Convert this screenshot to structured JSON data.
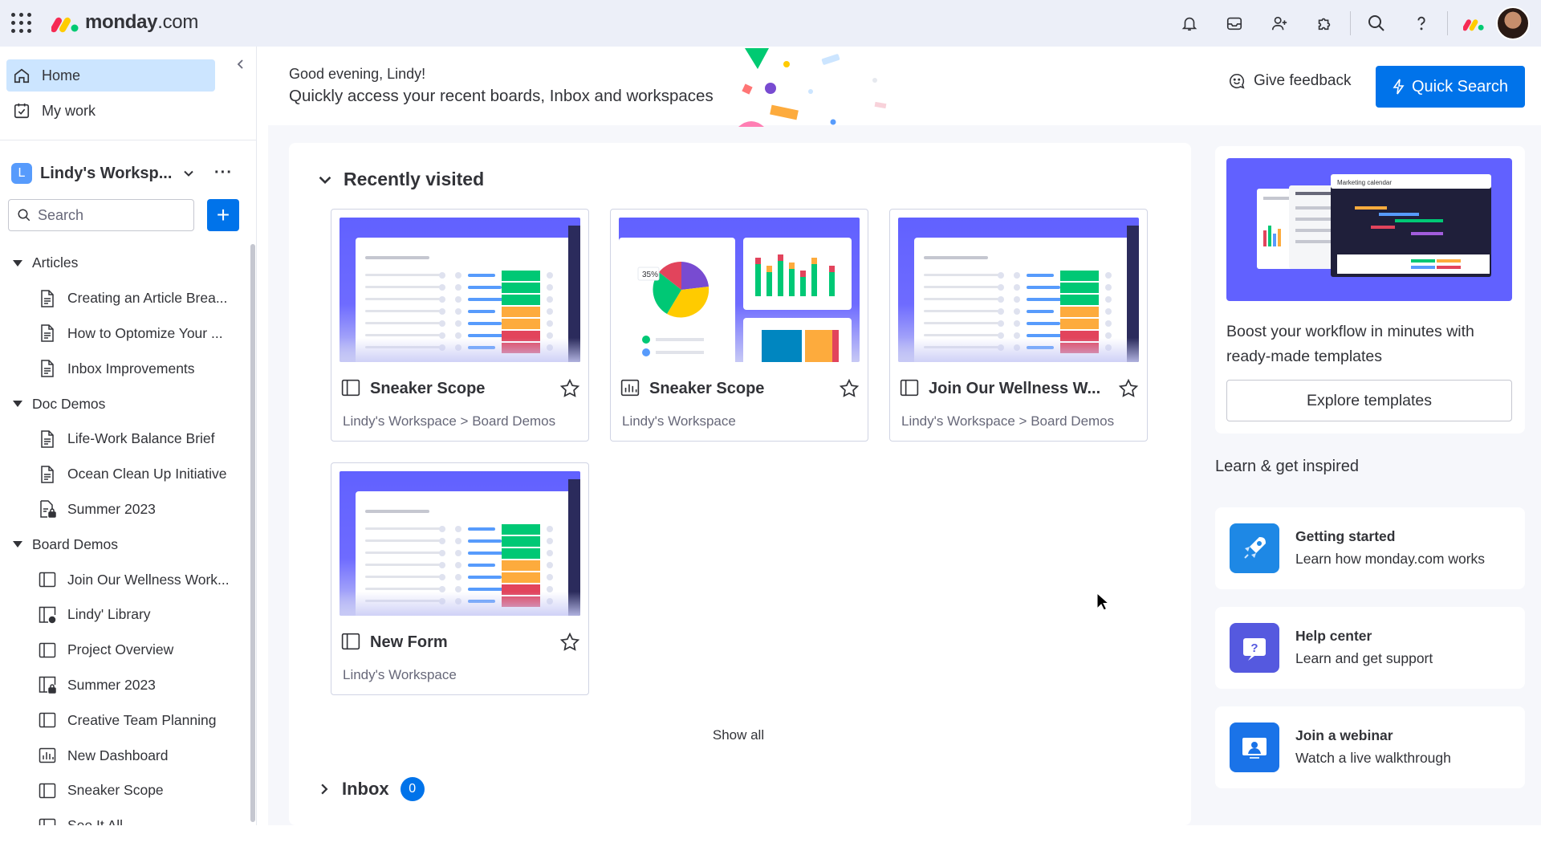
{
  "app": {
    "logo_bold": "monday",
    "logo_suffix": ".com"
  },
  "topbar": {
    "icons": [
      "bell-icon",
      "inbox-tray-icon",
      "invite-user-icon",
      "puzzle-icon",
      "search-icon",
      "help-icon",
      "monday-logo-icon",
      "avatar"
    ]
  },
  "sidebar": {
    "nav": [
      {
        "label": "Home",
        "icon": "home-icon",
        "active": true
      },
      {
        "label": "My work",
        "icon": "calendar-check-icon",
        "active": false
      }
    ],
    "workspace": {
      "badge": "L",
      "name": "Lindy's Worksp...",
      "more": "···"
    },
    "search_placeholder": "Search",
    "add_label": "+",
    "tree": [
      {
        "type": "folder",
        "label": "Articles"
      },
      {
        "type": "doc",
        "label": "Creating an Article Brea..."
      },
      {
        "type": "doc",
        "label": "How to Optomize Your ..."
      },
      {
        "type": "doc",
        "label": "Inbox Improvements"
      },
      {
        "type": "folder",
        "label": "Doc Demos"
      },
      {
        "type": "doc",
        "label": "Life-Work Balance Brief"
      },
      {
        "type": "doc",
        "label": "Ocean Clean Up Initiative"
      },
      {
        "type": "doc-lock",
        "label": "Summer 2023"
      },
      {
        "type": "folder",
        "label": "Board Demos"
      },
      {
        "type": "board",
        "label": "Join Our Wellness Work..."
      },
      {
        "type": "board-share",
        "label": "Lindy' Library"
      },
      {
        "type": "board",
        "label": "Project Overview"
      },
      {
        "type": "board-lock",
        "label": "Summer 2023"
      },
      {
        "type": "board",
        "label": "Creative Team Planning"
      },
      {
        "type": "dashboard",
        "label": "New Dashboard"
      },
      {
        "type": "board",
        "label": "Sneaker Scope"
      },
      {
        "type": "board",
        "label": "See It All"
      }
    ]
  },
  "header": {
    "greeting": "Good evening, Lindy!",
    "subtitle": "Quickly access your recent boards, Inbox and workspaces",
    "feedback_label": "Give feedback",
    "quick_search_label": "Quick Search"
  },
  "recent": {
    "title": "Recently visited",
    "cards": [
      {
        "title": "Sneaker Scope",
        "path": "Lindy's Workspace > Board Demos",
        "kind": "board"
      },
      {
        "title": "Sneaker Scope",
        "path": "Lindy's Workspace",
        "kind": "dashboard",
        "pie_label": "35%"
      },
      {
        "title": "Join Our Wellness W...",
        "path": "Lindy's Workspace > Board Demos",
        "kind": "board"
      },
      {
        "title": "New Form",
        "path": "Lindy's Workspace",
        "kind": "board"
      }
    ],
    "show_all": "Show all"
  },
  "inbox": {
    "title": "Inbox",
    "count": "0"
  },
  "templates": {
    "thumb_title": "Marketing calendar",
    "text": "Boost your workflow in minutes with ready-made templates",
    "button": "Explore templates"
  },
  "learn": {
    "title": "Learn & get inspired",
    "items": [
      {
        "title": "Getting started",
        "subtitle": "Learn how monday.com works",
        "icon": "rocket-icon"
      },
      {
        "title": "Help center",
        "subtitle": "Learn and get support",
        "icon": "help-center-icon"
      },
      {
        "title": "Join a webinar",
        "subtitle": "Watch a live walkthrough",
        "icon": "webinar-icon"
      }
    ]
  },
  "colors": {
    "primary": "#0073ea",
    "active_nav": "#cce5ff",
    "brand_purple": "#6161ff"
  }
}
